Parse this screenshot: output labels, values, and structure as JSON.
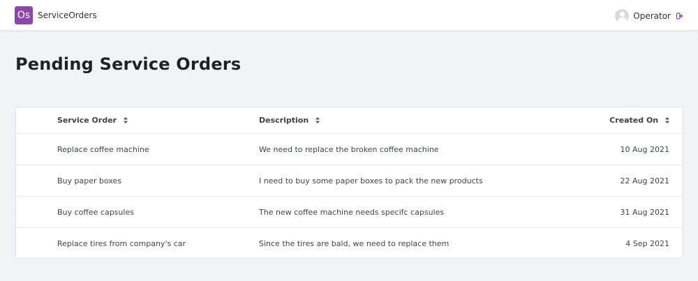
{
  "header": {
    "logo_text": "Os",
    "brand_name": "ServiceOrders",
    "user_name": "Operator",
    "accent_color": "#8e44ad"
  },
  "page": {
    "title": "Pending Service Orders"
  },
  "table": {
    "columns": [
      {
        "label": "Service Order",
        "sortable": true
      },
      {
        "label": "Description",
        "sortable": true
      },
      {
        "label": "Created On",
        "sortable": true
      }
    ],
    "rows": [
      {
        "order": "Replace coffee machine",
        "description": "We need to replace the broken coffee machine",
        "created": "10 Aug 2021"
      },
      {
        "order": "Buy paper boxes",
        "description": "I need to buy some paper boxes to pack the new products",
        "created": "22 Aug 2021"
      },
      {
        "order": "Buy coffee capsules",
        "description": "The new coffee machine needs specifc capsules",
        "created": "31 Aug 2021"
      },
      {
        "order": "Replace tires from company's car",
        "description": "Since the tires are bald, we need to replace them",
        "created": "4 Sep 2021"
      }
    ]
  },
  "icons": {
    "sort": "sort-icon",
    "logout": "logout-icon",
    "avatar": "user-avatar-icon"
  }
}
